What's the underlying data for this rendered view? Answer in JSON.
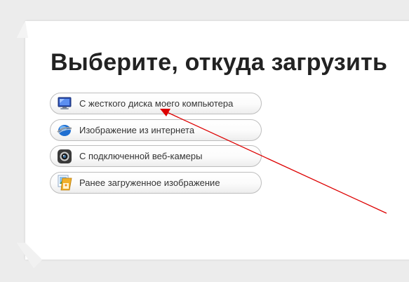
{
  "page": {
    "title": "Выберите, откуда загрузить"
  },
  "options": [
    {
      "label": "С жесткого диска моего компьютера",
      "icon": "computer-icon"
    },
    {
      "label": "Изображение из интернета",
      "icon": "globe-icon"
    },
    {
      "label": "С подключенной веб-камеры",
      "icon": "webcam-icon"
    },
    {
      "label": "Ранее загруженное изображение",
      "icon": "photos-icon"
    }
  ],
  "annotation": {
    "kind": "red-arrow",
    "color": "#dd0000",
    "points_to": "С жесткого диска моего компьютера"
  }
}
